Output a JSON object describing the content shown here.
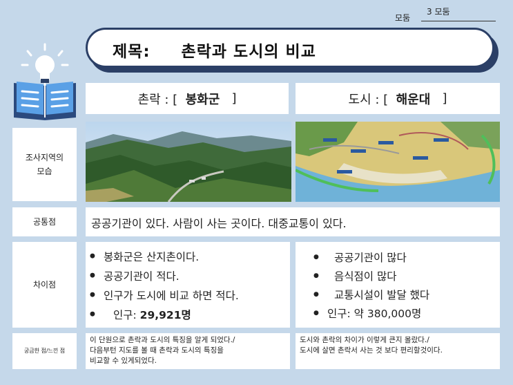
{
  "group": {
    "label": "모둠",
    "value": "3 모둠"
  },
  "title": "제목:     촌락과 도시의 비교",
  "rural": {
    "prefix": "촌락 : [  ",
    "name": "봉화군",
    "suffix": "   ]"
  },
  "urban": {
    "prefix": "도시 : [  ",
    "name": "해운대",
    "suffix": "   ]"
  },
  "rows": {
    "scene": "조사지역의\n모습",
    "common": "공통점",
    "diff": "차이점",
    "notes": "궁금한 점/느낀 점"
  },
  "common_text": "공공기관이 있다. 사람이 사는 곳이다. 대중교통이 있다.",
  "diff_rural": [
    "봉화군은 산지촌이다.",
    "공공기관이 적다.",
    "인구가 도시에 비교 하면 적다."
  ],
  "rural_pop_label": "인구: ",
  "rural_pop_value": "29,921명",
  "diff_urban": [
    "공공기관이 많다",
    "음식점이 많다",
    "교통시설이 발달 했다",
    "인구: 약 380,000명"
  ],
  "note_rural": "이 단원으로 촌락과 도시의 특징을 알게 되었다./\n다음부턴 지도를 볼 때 촌락과 도시의 특징을\n비교할 수 있게되었다.",
  "note_urban": "도시와 촌락의 차이가 이렇게 큰지 몰랐다./\n도시에 살면 촌락서 사는 것 보다 편리할것이다."
}
